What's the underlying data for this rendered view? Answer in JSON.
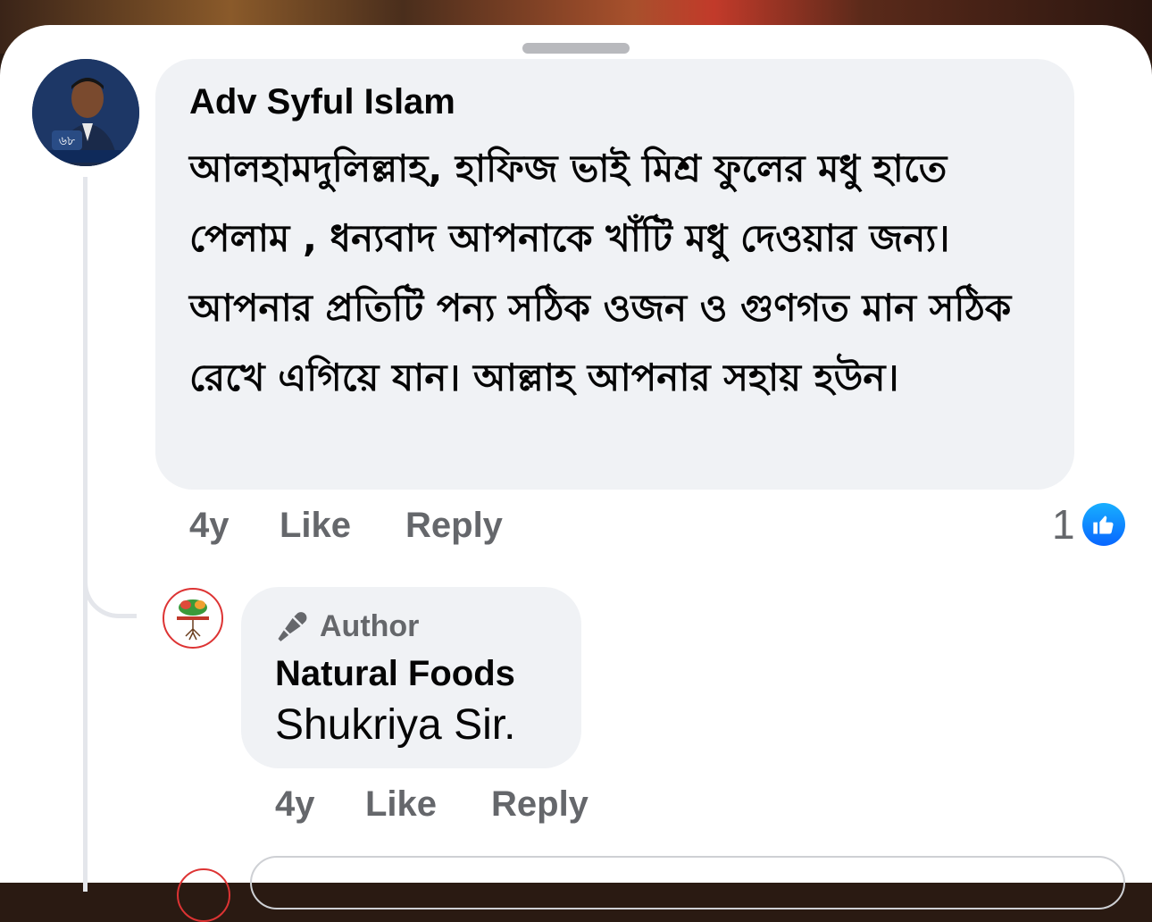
{
  "comment": {
    "author": "Adv Syful Islam",
    "text": "আলহামদুলিল্লাহ, হাফিজ ভাই মিশ্র ফুলের মধু হাতে পেলাম , ধন্যবাদ আপনাকে খাঁটি মধু দেওয়ার জন্য। আপনার প্রতিটি পন্য সঠিক ওজন ও গুণগত মান সঠিক রেখে এগিয়ে যান। আল্লাহ আপনার সহায় হউন।",
    "time": "4y",
    "like_label": "Like",
    "reply_label": "Reply",
    "reaction_count": "1",
    "reaction_icon": "like-thumb-icon",
    "avatar_badge_text": "৬৮"
  },
  "reply": {
    "badge_label": "Author",
    "badge_icon": "microphone-icon",
    "author": "Natural Foods",
    "text": "Shukriya Sir.",
    "time": "4y",
    "like_label": "Like",
    "reply_label": "Reply"
  },
  "colors": {
    "bubble_bg": "#f0f2f5",
    "meta_text": "#65676b",
    "primary_text": "#050505",
    "like_blue": "#0866ff"
  }
}
